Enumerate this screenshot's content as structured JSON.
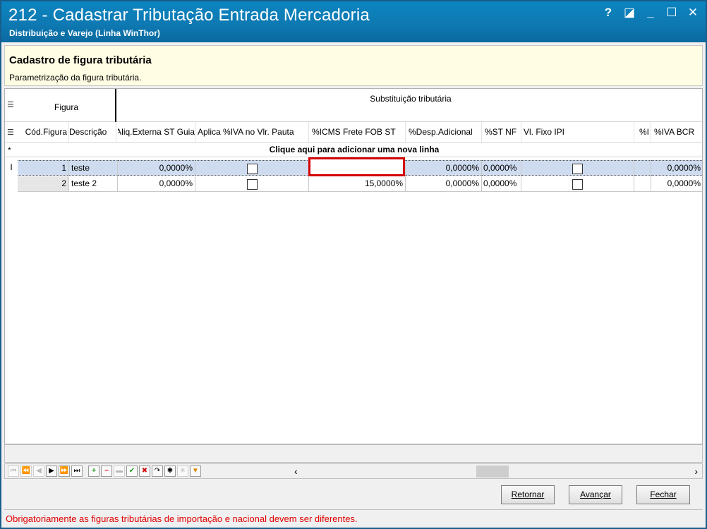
{
  "window": {
    "title": "212 - Cadastrar Tributação Entrada Mercadoria",
    "subtitle": "Distribuição e Varejo (Linha WinThor)",
    "controls": {
      "help": "?",
      "restore_alt": "◪",
      "minimize": "_",
      "maximize": "☐",
      "close": "✕"
    }
  },
  "header": {
    "title": "Cadastro de figura tributária",
    "description": "Parametrização da figura tributária."
  },
  "grid": {
    "bands": {
      "figura": "Figura",
      "substituicao": "Substituição tributária"
    },
    "columns": [
      "Cód.Figura",
      "Descrição",
      "Aliq.Externa ST Guia",
      "Aplica %IVA no Vlr. Pauta",
      "%ICMS Frete FOB ST",
      "%Desp.Adicional",
      "%ST NF",
      "Vl. Fixo IPI",
      "%I",
      "%IVA BCR"
    ],
    "new_row_text": "Clique aqui para adicionar uma nova linha",
    "rows": [
      {
        "cod": "1",
        "descricao": "teste",
        "aliq_externa": "0,0000%",
        "aplica_iva": false,
        "icms_frete": "",
        "desp_adicional": "0,0000%",
        "st_nf": "0,0000%",
        "vl_fixo_ipi": false,
        "pct_i": "",
        "iva_bcr": "0,0000%"
      },
      {
        "cod": "2",
        "descricao": "teste 2",
        "aliq_externa": "0,0000%",
        "aplica_iva": false,
        "icms_frete": "15,0000%",
        "desp_adicional": "0,0000%",
        "st_nf": "0,0000%",
        "vl_fixo_ipi": false,
        "pct_i": "",
        "iva_bcr": "0,0000%"
      }
    ]
  },
  "buttons": {
    "retornar": "Retornar",
    "avancar": "Avançar",
    "fechar": "Fechar"
  },
  "status_message": "Obrigatoriamente as figuras tributárias de importação e nacional devem ser diferentes.",
  "colors": {
    "titlebar": "#0b85c0",
    "header_bg": "#fffde3",
    "selected_row": "#cfdcf0",
    "highlight": "#d40000",
    "status_text": "#e00000"
  }
}
